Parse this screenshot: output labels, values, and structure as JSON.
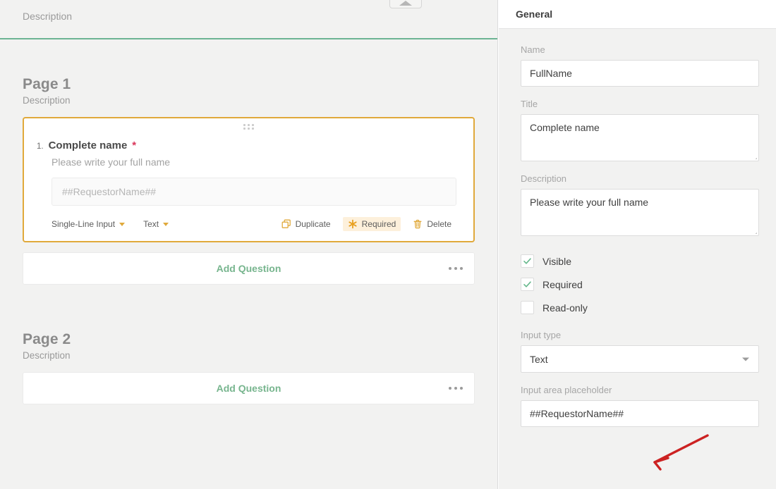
{
  "left_pane": {
    "form_header": {
      "description": "Description",
      "collapse_icon": "chevron-up-icon"
    },
    "pages": [
      {
        "title": "Page 1",
        "description": "Description",
        "has_question": true,
        "question": {
          "drag_handle_icon": "drag-handle-icon",
          "number": "1.",
          "title": "Complete name",
          "required_marker": "*",
          "description": "Please write your full name",
          "input_placeholder": "##RequestorName##",
          "toolbar": {
            "field_type": "Single-Line Input",
            "field_type_caret_icon": "caret-down-icon",
            "input_type": "Text",
            "input_type_caret_icon": "caret-down-icon",
            "duplicate_label": "Duplicate",
            "duplicate_icon": "copy-icon",
            "required_label": "Required",
            "required_icon": "asterisk-icon",
            "required_active": true,
            "delete_label": "Delete",
            "delete_icon": "trash-icon"
          }
        },
        "add_question_label": "Add Question",
        "more_menu_icon": "ellipsis-icon"
      },
      {
        "title": "Page 2",
        "description": "Description",
        "has_question": false,
        "add_question_label": "Add Question",
        "more_menu_icon": "ellipsis-icon"
      }
    ]
  },
  "right_pane": {
    "header_title": "General",
    "fields": {
      "name": {
        "label": "Name",
        "value": "FullName"
      },
      "title": {
        "label": "Title",
        "value": "Complete name"
      },
      "description": {
        "label": "Description",
        "value": "Please write your full name"
      },
      "input_type": {
        "label": "Input type",
        "value": "Text",
        "caret_icon": "caret-down-icon"
      },
      "input_area_placeholder": {
        "label": "Input area placeholder",
        "value": "##RequestorName##"
      }
    },
    "checkboxes": [
      {
        "label": "Visible",
        "checked": true,
        "icon": "check-icon"
      },
      {
        "label": "Required",
        "checked": true,
        "icon": "check-icon"
      },
      {
        "label": "Read-only",
        "checked": false,
        "icon": "check-icon"
      }
    ]
  },
  "annotation": {
    "arrow_icon": "red-arrow-icon",
    "color": "#cc2222"
  },
  "colors": {
    "accent_green": "#6cb493",
    "add_question_green": "#77b58e",
    "card_border_orange": "#e0a93b",
    "required_badge_bg": "#fdf0db",
    "required_star_red": "#d9365a",
    "page_background": "#f2f2f1",
    "annotation_red": "#cc2222"
  }
}
